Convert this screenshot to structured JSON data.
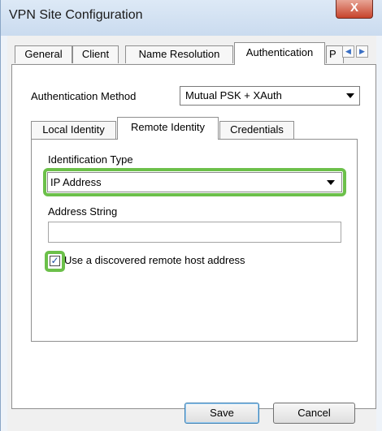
{
  "window": {
    "title": "VPN Site Configuration",
    "close_glyph": "X"
  },
  "tabs_top": [
    {
      "label": "General"
    },
    {
      "label": "Client"
    },
    {
      "label": "Name Resolution"
    },
    {
      "label": "Authentication",
      "active": true
    },
    {
      "label": "P"
    }
  ],
  "tab_scroll": {
    "left_glyph": "◀",
    "right_glyph": "▶"
  },
  "auth": {
    "label": "Authentication Method",
    "value": "Mutual PSK + XAuth"
  },
  "tabs_inner": [
    {
      "label": "Local Identity"
    },
    {
      "label": "Remote Identity",
      "active": true
    },
    {
      "label": "Credentials"
    }
  ],
  "identification": {
    "label": "Identification Type",
    "value": "IP Address"
  },
  "address": {
    "label": "Address String",
    "value": ""
  },
  "discovered": {
    "label": "Use a discovered remote host address",
    "checked": true,
    "check_glyph": "✓"
  },
  "buttons": {
    "save": "Save",
    "cancel": "Cancel"
  },
  "colors": {
    "highlight": "#6cc04a",
    "close": "#c7442c"
  }
}
